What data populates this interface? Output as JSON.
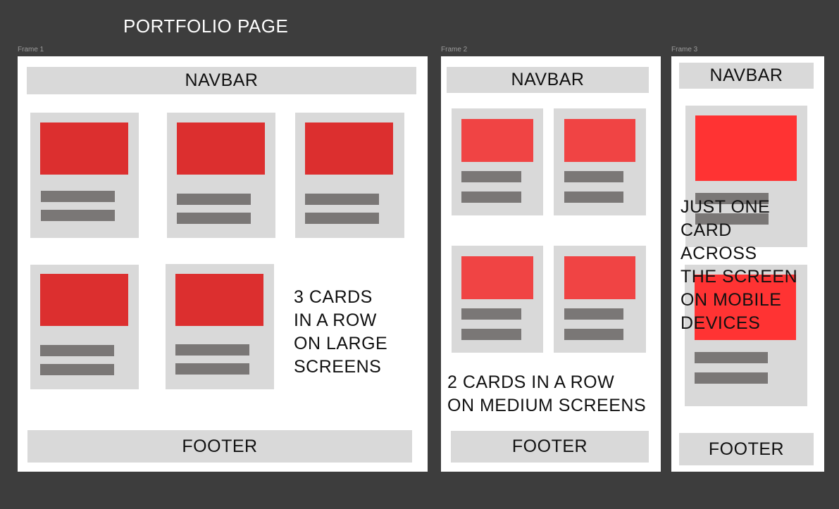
{
  "page_title": "PORTFOLIO PAGE",
  "colors": {
    "canvas": "#3d3d3d",
    "frame_bg": "#ffffff",
    "block_gray": "#d9d9d9",
    "text_line_gray": "#7a7776",
    "image_red_large": "#dc2f2f",
    "image_red_medium": "#f04444",
    "image_red_mobile": "#ff3333"
  },
  "frames": [
    {
      "label": "Frame 1",
      "navbar": "NAVBAR",
      "footer": "FOOTER",
      "note": "3 CARDS IN A ROW ON LARGE SCREENS",
      "note_lines": [
        "3 CARDS",
        "IN A ROW",
        "ON LARGE",
        "SCREENS"
      ],
      "card_count": 5
    },
    {
      "label": "Frame 2",
      "navbar": "NAVBAR",
      "footer": "FOOTER",
      "note": "2 CARDS IN A ROW ON MEDIUM SCREENS",
      "note_lines": [
        "2 CARDS IN A ROW",
        "ON MEDIUM SCREENS"
      ],
      "card_count": 4
    },
    {
      "label": "Frame 3",
      "navbar": "NAVBAR",
      "footer": "FOOTER",
      "note": "JUST ONE CARD ACROSS THE SCREEN ON MOBILE DEVICES",
      "note_lines": [
        "JUST ONE",
        "CARD",
        "ACROSS",
        "THE SCREEN",
        "ON MOBILE",
        "DEVICES"
      ],
      "card_count": 2
    }
  ]
}
